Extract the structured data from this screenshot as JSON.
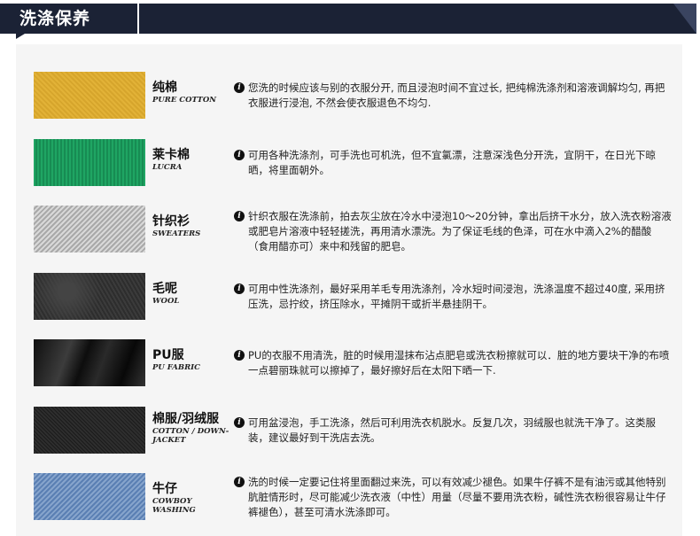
{
  "header": {
    "title": "洗涤保养"
  },
  "items": [
    {
      "name_cn": "纯棉",
      "name_en": "PURE COTTON",
      "text": "您洗的时候应该与别的衣服分开, 而且浸泡时间不宜过长, 把纯棉洗涤剂和溶液调解均匀, 再把衣服进行浸泡, 不然会使衣服退色不均匀."
    },
    {
      "name_cn": "莱卡棉",
      "name_en": "LUCRA",
      "text": "可用各种洗涤剂，可手洗也可机洗，但不宜氯漂，注意深浅色分开洗，宜阴干，在日光下晾晒，将里面朝外。"
    },
    {
      "name_cn": "针织衫",
      "name_en": "SWEATERS",
      "text": "针织衣服在洗涤前，拍去灰尘放在冷水中浸泡10～20分钟，拿出后挤干水分，放入洗衣粉溶液或肥皂片溶液中轻轻搓洗，再用清水漂洗。为了保证毛线的色泽，可在水中滴入2%的醋酸（食用醋亦可）来中和残留的肥皂。"
    },
    {
      "name_cn": "毛呢",
      "name_en": "WOOL",
      "text": "可用中性洗涤剂，最好采用羊毛专用洗涤剂，冷水短时间浸泡，洗涤温度不超过40度, 采用挤压洗，忌拧绞，挤压除水，平摊阴干或折半悬挂阴干。"
    },
    {
      "name_cn": "PU服",
      "name_en": "PU FABRIC",
      "text": "PU的衣服不用清洗，脏的时候用湿抹布沾点肥皂或洗衣粉擦就可以．脏的地方要块干净的布喷一点碧丽珠就可以擦掉了，最好擦好后在太阳下晒一下."
    },
    {
      "name_cn": "棉服/羽绒服",
      "name_en": "COTTON / DOWN-JACKET",
      "text": "可用盆浸泡，手工洗涤，然后可利用洗衣机脱水。反复几次，羽绒服也就洗干净了。这类服装，建议最好到干洗店去洗。"
    },
    {
      "name_cn": "牛仔",
      "name_en": "COWBOY WASHING",
      "text": "洗的时候一定要记住将里面翻过来洗，可以有效减少褪色。如果牛仔裤不是有油污或其他特别肮脏情形时，尽可能减少洗衣液（中性）用量（尽量不要用洗衣粉，碱性洗衣粉很容易让牛仔裤褪色），甚至可清水洗涤即可。"
    }
  ]
}
